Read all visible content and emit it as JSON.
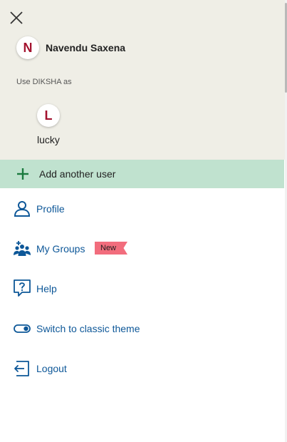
{
  "header": {
    "current_user": {
      "initial": "N",
      "name": "Navendu Saxena"
    },
    "use_as_label": "Use DIKSHA as",
    "other_users": [
      {
        "initial": "L",
        "name": "lucky"
      }
    ],
    "add_user_label": "Add another user"
  },
  "menu": {
    "items": [
      {
        "label": "Profile",
        "icon": "profile-icon"
      },
      {
        "label": "My Groups",
        "icon": "groups-icon",
        "badge": "New"
      },
      {
        "label": "Help",
        "icon": "help-icon"
      },
      {
        "label": "Switch to classic theme",
        "icon": "toggle-icon"
      },
      {
        "label": "Logout",
        "icon": "logout-icon"
      }
    ]
  },
  "colors": {
    "panel_bg": "#efeee6",
    "add_user_bg": "#c0e2cf",
    "link_blue": "#0d5798",
    "avatar_red": "#a3122e",
    "badge_pink": "#f26d7d",
    "plus_green": "#1a7a3e"
  }
}
